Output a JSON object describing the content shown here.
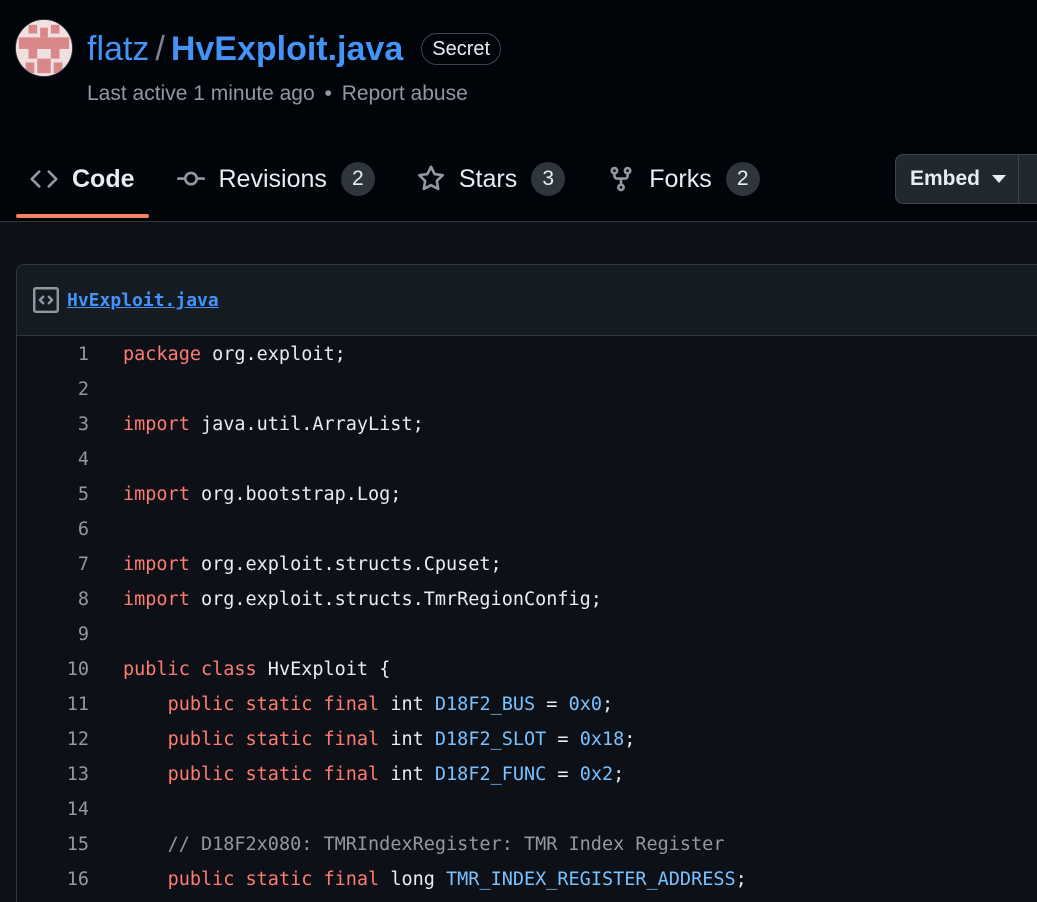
{
  "gist": {
    "owner": "flatz",
    "separator": "/",
    "filename": "HvExploit.java",
    "visibility_badge": "Secret",
    "last_active": "Last active 1 minute ago",
    "meta_separator": "•",
    "report_abuse": "Report abuse"
  },
  "tabs": [
    {
      "label": "Code",
      "icon": "code-icon",
      "active": true
    },
    {
      "label": "Revisions",
      "count": "2",
      "icon": "git-commit-icon"
    },
    {
      "label": "Stars",
      "count": "3",
      "icon": "star-icon"
    },
    {
      "label": "Forks",
      "count": "2",
      "icon": "repo-forked-icon"
    }
  ],
  "embed": {
    "label": "Embed"
  },
  "file": {
    "name": "HvExploit.java",
    "icon": "file-code-icon",
    "lines": [
      {
        "n": "1",
        "tokens": [
          [
            "kw",
            "package"
          ],
          [
            "ty",
            " org.exploit;"
          ]
        ]
      },
      {
        "n": "2",
        "tokens": []
      },
      {
        "n": "3",
        "tokens": [
          [
            "kw",
            "import"
          ],
          [
            "ty",
            " java.util.ArrayList;"
          ]
        ]
      },
      {
        "n": "4",
        "tokens": []
      },
      {
        "n": "5",
        "tokens": [
          [
            "kw",
            "import"
          ],
          [
            "ty",
            " org.bootstrap.Log;"
          ]
        ]
      },
      {
        "n": "6",
        "tokens": []
      },
      {
        "n": "7",
        "tokens": [
          [
            "kw",
            "import"
          ],
          [
            "ty",
            " org.exploit.structs.Cpuset;"
          ]
        ]
      },
      {
        "n": "8",
        "tokens": [
          [
            "kw",
            "import"
          ],
          [
            "ty",
            " org.exploit.structs.TmrRegionConfig;"
          ]
        ]
      },
      {
        "n": "9",
        "tokens": []
      },
      {
        "n": "10",
        "tokens": [
          [
            "kw",
            "public"
          ],
          [
            "ty",
            " "
          ],
          [
            "kw",
            "class"
          ],
          [
            "ty",
            " HvExploit {"
          ]
        ]
      },
      {
        "n": "11",
        "tokens": [
          [
            "ty",
            "    "
          ],
          [
            "kw",
            "public"
          ],
          [
            "ty",
            " "
          ],
          [
            "kw",
            "static"
          ],
          [
            "ty",
            " "
          ],
          [
            "kw",
            "final"
          ],
          [
            "ty",
            " int "
          ],
          [
            "cn",
            "D18F2_BUS"
          ],
          [
            "ty",
            " = "
          ],
          [
            "cn",
            "0x0"
          ],
          [
            "ty",
            ";"
          ]
        ]
      },
      {
        "n": "12",
        "tokens": [
          [
            "ty",
            "    "
          ],
          [
            "kw",
            "public"
          ],
          [
            "ty",
            " "
          ],
          [
            "kw",
            "static"
          ],
          [
            "ty",
            " "
          ],
          [
            "kw",
            "final"
          ],
          [
            "ty",
            " int "
          ],
          [
            "cn",
            "D18F2_SLOT"
          ],
          [
            "ty",
            " = "
          ],
          [
            "cn",
            "0x18"
          ],
          [
            "ty",
            ";"
          ]
        ]
      },
      {
        "n": "13",
        "tokens": [
          [
            "ty",
            "    "
          ],
          [
            "kw",
            "public"
          ],
          [
            "ty",
            " "
          ],
          [
            "kw",
            "static"
          ],
          [
            "ty",
            " "
          ],
          [
            "kw",
            "final"
          ],
          [
            "ty",
            " int "
          ],
          [
            "cn",
            "D18F2_FUNC"
          ],
          [
            "ty",
            " = "
          ],
          [
            "cn",
            "0x2"
          ],
          [
            "ty",
            ";"
          ]
        ]
      },
      {
        "n": "14",
        "tokens": []
      },
      {
        "n": "15",
        "tokens": [
          [
            "ty",
            "    "
          ],
          [
            "cm",
            "// D18F2x080: TMRIndexRegister: TMR Index Register"
          ]
        ]
      },
      {
        "n": "16",
        "tokens": [
          [
            "ty",
            "    "
          ],
          [
            "kw",
            "public"
          ],
          [
            "ty",
            " "
          ],
          [
            "kw",
            "static"
          ],
          [
            "ty",
            " "
          ],
          [
            "kw",
            "final"
          ],
          [
            "ty",
            " long "
          ],
          [
            "cn",
            "TMR_INDEX_REGISTER_ADDRESS"
          ],
          [
            "ty",
            ";"
          ]
        ]
      }
    ]
  },
  "colors": {
    "link": "#4493f8",
    "keyword": "#ff7b72",
    "constant": "#79c0ff",
    "comment": "#9198a1",
    "active_tab_underline": "#f78166"
  }
}
